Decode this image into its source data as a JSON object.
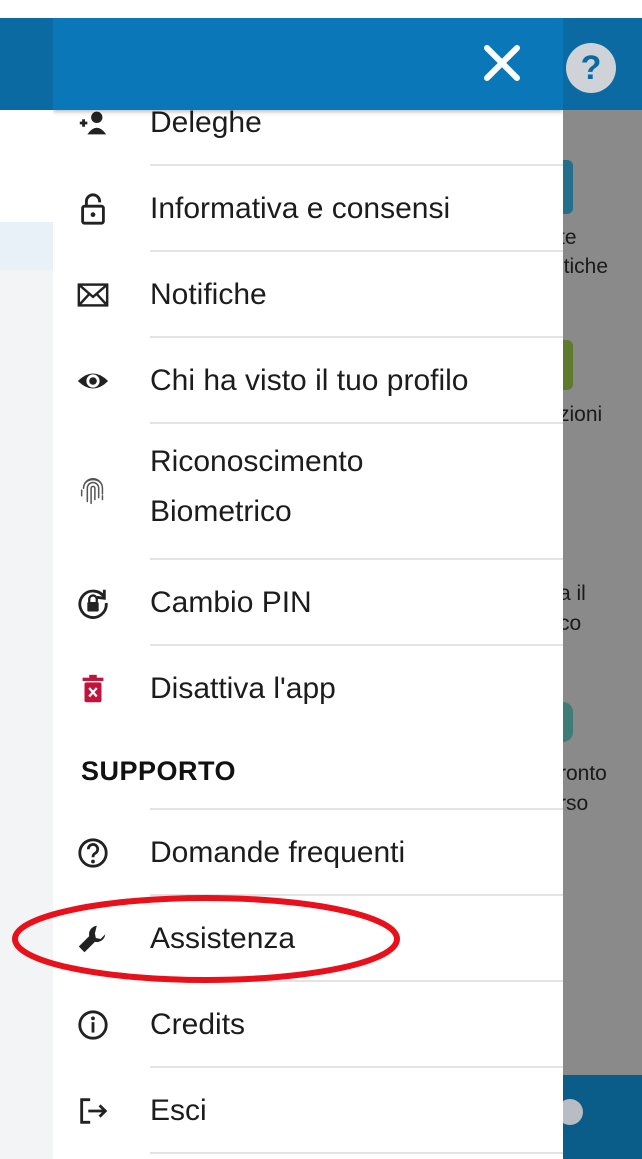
{
  "header": {
    "help_label": "?",
    "close_icon": "close-icon",
    "color": "#0a78b8"
  },
  "background": {
    "partial_texts": [
      "te",
      "itiche",
      "zioni",
      "a il",
      "co",
      "ronto",
      "rso"
    ]
  },
  "menu": {
    "items": [
      {
        "label": "Deleghe",
        "icon": "delegation-icon"
      },
      {
        "label": "Informativa e consensi",
        "icon": "lock-icon"
      },
      {
        "label": "Notifiche",
        "icon": "envelope-icon"
      },
      {
        "label": "Chi ha visto il tuo profilo",
        "icon": "eye-icon"
      },
      {
        "label": "Riconoscimento",
        "label2": "Biometrico",
        "icon": "fingerprint-icon"
      },
      {
        "label": "Cambio PIN",
        "icon": "pin-change-icon"
      },
      {
        "label": "Disattiva l'app",
        "icon": "trash-icon",
        "icon_color": "#c0143c"
      }
    ],
    "support_section": {
      "title": "SUPPORTO",
      "items": [
        {
          "label": "Domande frequenti",
          "icon": "question-circle-icon"
        },
        {
          "label": "Assistenza",
          "icon": "wrench-icon"
        },
        {
          "label": "Credits",
          "icon": "info-icon"
        },
        {
          "label": "Esci",
          "icon": "logout-icon"
        }
      ]
    }
  },
  "annotation": {
    "target": "Assistenza",
    "color": "#e8101a"
  }
}
